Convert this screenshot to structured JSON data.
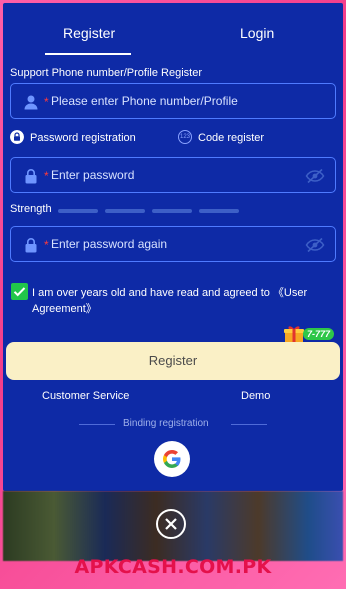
{
  "tabs": {
    "register": "Register",
    "login": "Login"
  },
  "phone_section": {
    "label": "Support Phone number/Profile Register",
    "required_mark": "*",
    "placeholder": "Please enter Phone number/Profile"
  },
  "options": {
    "password_registration": "Password registration",
    "code_register": "Code register",
    "code_icon_text": "123"
  },
  "password_field": {
    "required_mark": "*",
    "placeholder": "Enter password"
  },
  "strength": {
    "label": "Strength"
  },
  "confirm_field": {
    "required_mark": "*",
    "placeholder": "Enter password again"
  },
  "agreement": {
    "checked": true,
    "text": "I am over years old and have read and agreed to 《User Agreement》"
  },
  "promo": {
    "badge_text": "7-777"
  },
  "register_button": "Register",
  "links": {
    "customer_service": "Customer Service",
    "demo": "Demo"
  },
  "binding_label": "Binding registration",
  "watermark": "APKCASH.COM.PK",
  "colors": {
    "panel_bg": "#0e2aa6",
    "field_border": "#4f7bff",
    "accent_button": "#faf0c6",
    "checkbox": "#21c64a",
    "required": "#ff3b3b",
    "watermark": "#e4114b",
    "frame": "#f33d8a"
  },
  "icons": [
    "user-icon",
    "lock-icon",
    "eye-off-icon",
    "google-icon",
    "close-icon",
    "gift-icon",
    "checkmark-icon"
  ]
}
